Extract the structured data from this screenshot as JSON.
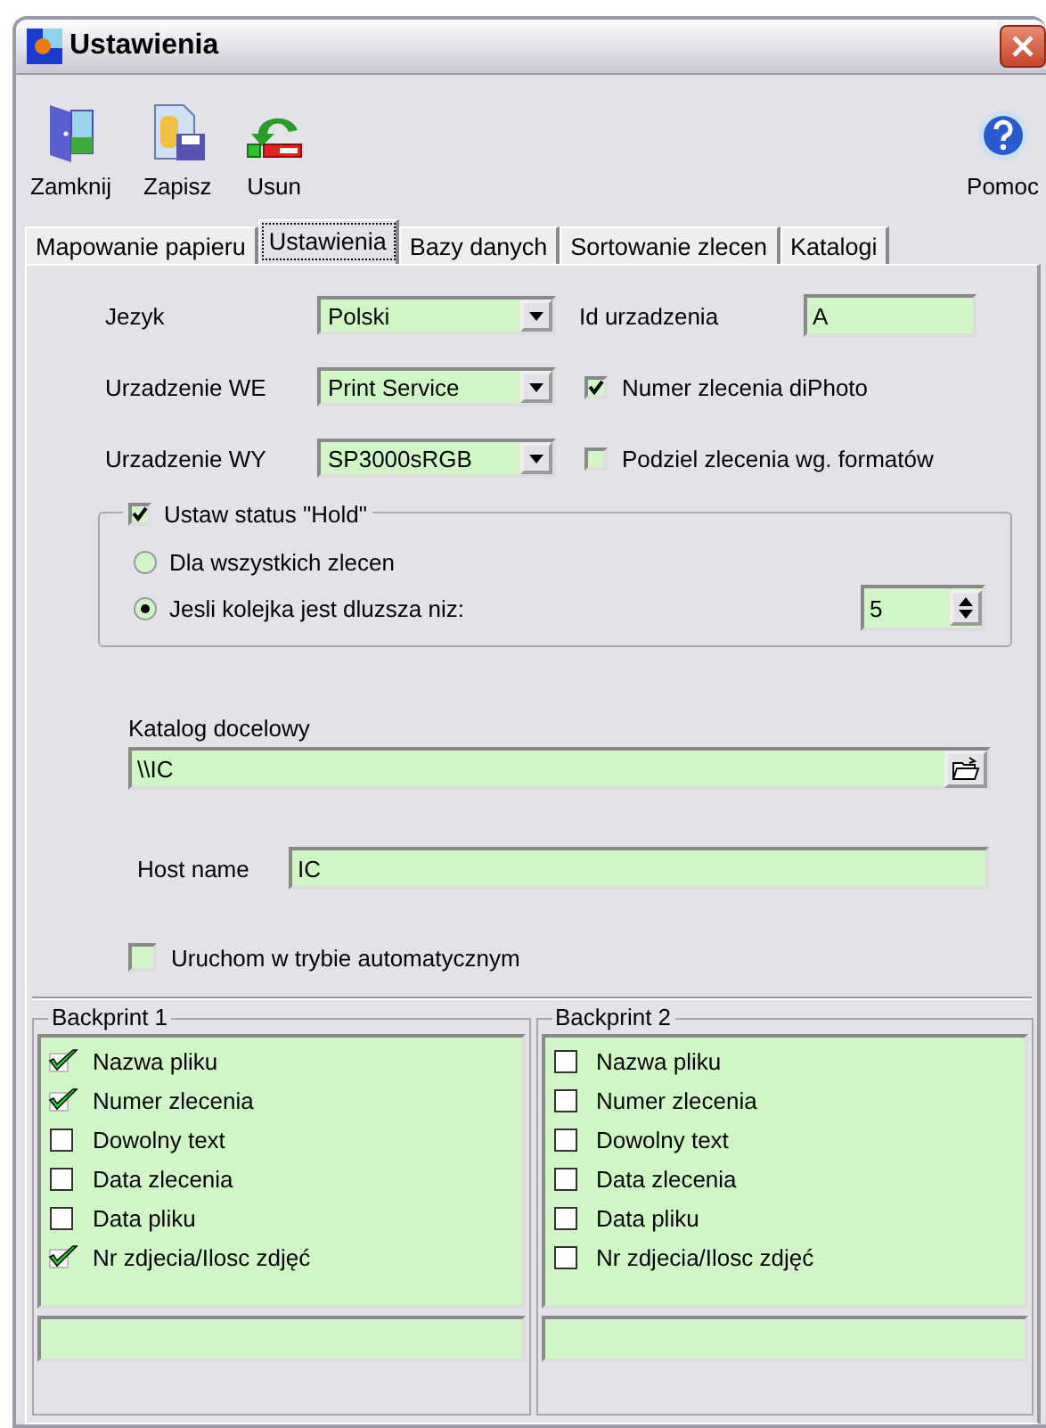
{
  "window": {
    "title": "Ustawienia"
  },
  "toolbar": [
    {
      "label": "Zamknij",
      "kind": "close"
    },
    {
      "label": "Zapisz",
      "kind": "save"
    },
    {
      "label": "Usun",
      "kind": "delete"
    },
    {
      "label": "Pomoc",
      "kind": "help"
    }
  ],
  "tabs": [
    {
      "label": "Mapowanie papieru",
      "selected": false
    },
    {
      "label": "Ustawienia",
      "selected": true
    },
    {
      "label": "Bazy danych",
      "selected": false
    },
    {
      "label": "Sortowanie zlecen",
      "selected": false
    },
    {
      "label": "Katalogi",
      "selected": false
    }
  ],
  "settings": {
    "language": {
      "label": "Jezyk",
      "value": "Polski"
    },
    "device_id": {
      "label": "Id urzadzenia",
      "value": "A"
    },
    "input_device": {
      "label": "Urzadzenie WE",
      "value": "Print Service"
    },
    "output_device": {
      "label": "Urzadzenie WY",
      "value": "SP3000sRGB"
    },
    "diphoto_number": {
      "label": "Numer zlecenia diPhoto",
      "checked": true
    },
    "split_orders": {
      "label": "Podziel zlecenia wg. formatów",
      "checked": false
    }
  },
  "hold": {
    "label": "Ustaw status \"Hold\"",
    "checked": true,
    "options": [
      {
        "label": "Dla wszystkich zlecen",
        "selected": false
      },
      {
        "label": "Jesli kolejka jest dluzsza niz:",
        "selected": true
      }
    ],
    "queue_length": "5"
  },
  "target_folder": {
    "label": "Katalog docelowy",
    "value": "\\\\IC"
  },
  "host_name": {
    "label": "Host name",
    "value": "IC"
  },
  "auto_start": {
    "label": "Uruchom w trybie automatycznym",
    "checked": false
  },
  "backprints": [
    {
      "title": "Backprint 1",
      "items": [
        {
          "label": "Nazwa pliku",
          "checked": true
        },
        {
          "label": "Numer zlecenia",
          "checked": true
        },
        {
          "label": "Dowolny text",
          "checked": false
        },
        {
          "label": "Data zlecenia",
          "checked": false
        },
        {
          "label": "Data pliku",
          "checked": false
        },
        {
          "label": "Nr zdjecia/Ilosc zdjęć",
          "checked": true
        }
      ]
    },
    {
      "title": "Backprint 2",
      "items": [
        {
          "label": "Nazwa pliku",
          "checked": false
        },
        {
          "label": "Numer zlecenia",
          "checked": false
        },
        {
          "label": "Dowolny text",
          "checked": false
        },
        {
          "label": "Data zlecenia",
          "checked": false
        },
        {
          "label": "Data pliku",
          "checked": false
        },
        {
          "label": "Nr zdjecia/Ilosc zdjęć",
          "checked": false
        }
      ]
    }
  ]
}
